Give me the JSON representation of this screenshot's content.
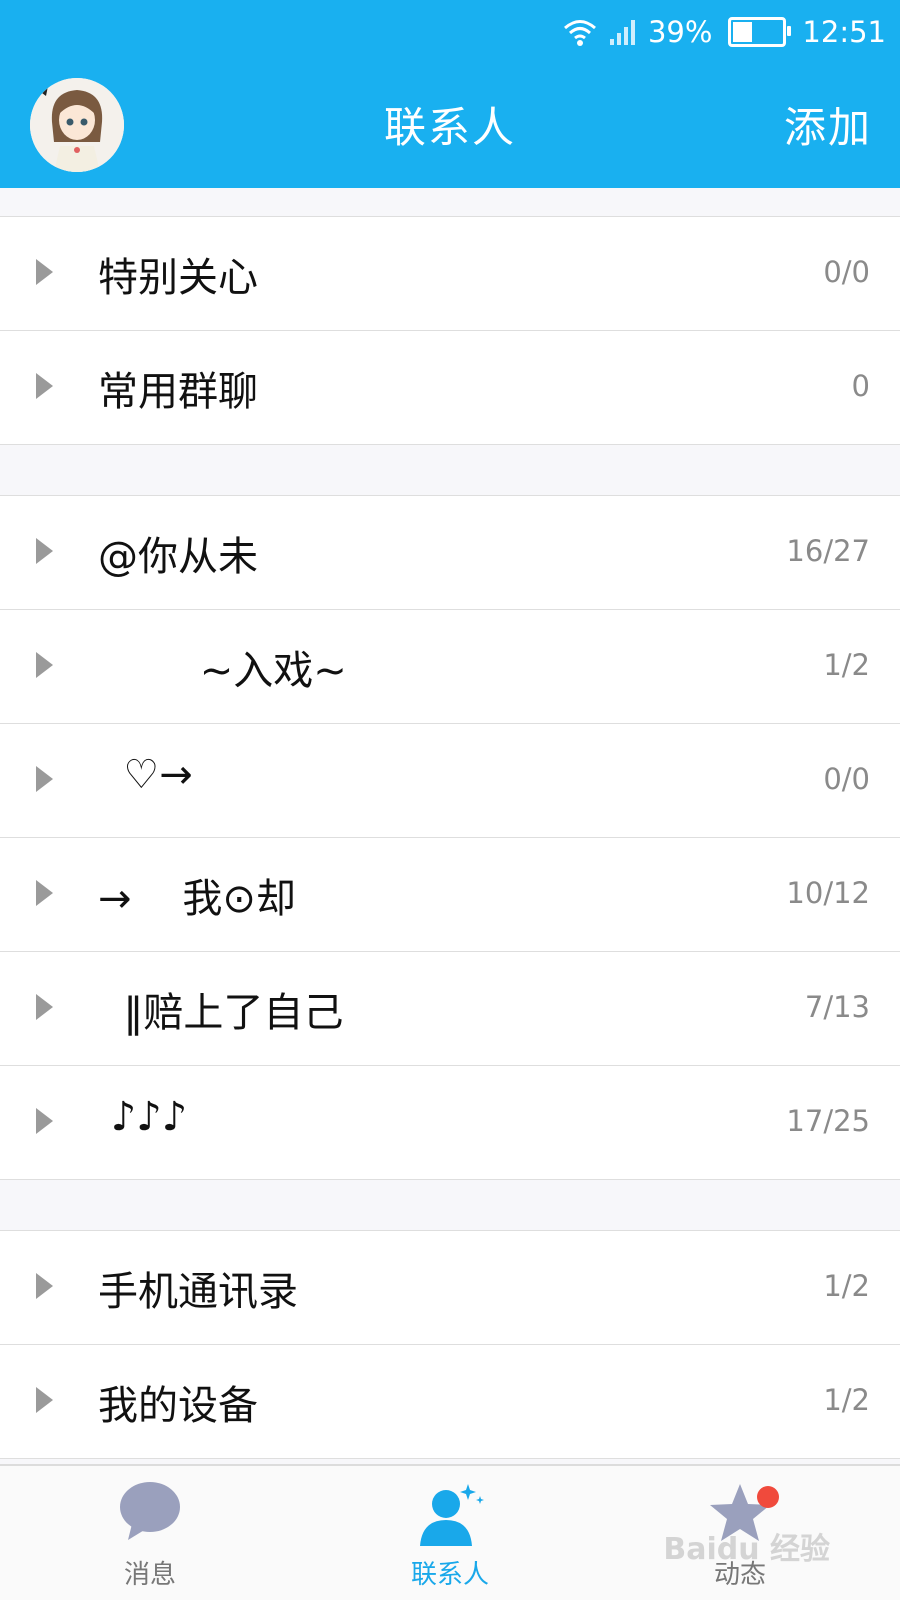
{
  "status": {
    "battery": "39%",
    "time": "12:51",
    "battery_level": 0.39
  },
  "header": {
    "title": "联系人",
    "add_label": "添加"
  },
  "groups": [
    {
      "rows": [
        {
          "label": "特别关心",
          "count": "0/0"
        },
        {
          "label": "常用群聊",
          "count": "0"
        }
      ]
    },
    {
      "rows": [
        {
          "label": "@你从未",
          "count": "16/27"
        },
        {
          "label": "        ~入戏~",
          "count": "1/2"
        },
        {
          "label": "  ♡→",
          "count": "0/0"
        },
        {
          "label": "→    我⊙却",
          "count": "10/12"
        },
        {
          "label": "  ‖赔上了自己",
          "count": "7/13"
        },
        {
          "label": " ♪♪♪",
          "count": "17/25"
        }
      ]
    },
    {
      "rows": [
        {
          "label": "手机通讯录",
          "count": "1/2"
        },
        {
          "label": "我的设备",
          "count": "1/2"
        }
      ]
    }
  ],
  "tabs": [
    {
      "label": "消息",
      "icon": "chat-bubble-icon",
      "active": false
    },
    {
      "label": "联系人",
      "icon": "contacts-icon",
      "active": true
    },
    {
      "label": "动态",
      "icon": "star-icon",
      "active": false
    }
  ],
  "watermark": "Baidu 经验",
  "colors": {
    "primary": "#19b0f0",
    "active_tab": "#19a8ea",
    "badge": "#f04a3c"
  }
}
